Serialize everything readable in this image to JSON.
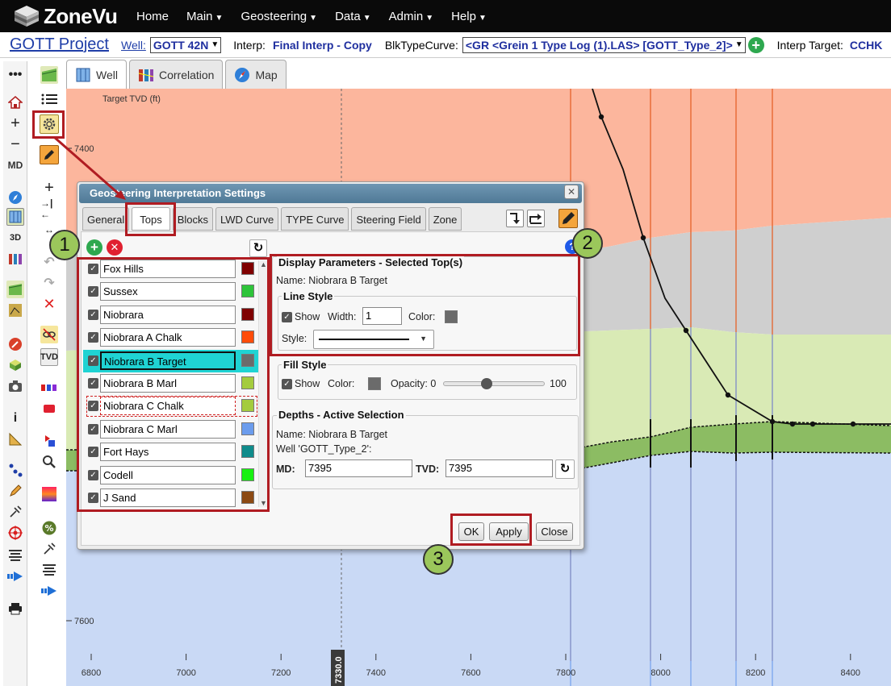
{
  "app": {
    "logo": "ZoneVu"
  },
  "nav": [
    {
      "label": "Home",
      "caret": false
    },
    {
      "label": "Main",
      "caret": true
    },
    {
      "label": "Geosteering",
      "caret": true
    },
    {
      "label": "Data",
      "caret": true
    },
    {
      "label": "Admin",
      "caret": true
    },
    {
      "label": "Help",
      "caret": true
    }
  ],
  "projbar": {
    "project": "GOTT Project",
    "well_label": "Well:",
    "well_value": "GOTT 42N",
    "interp_label": "Interp:",
    "interp_value": "Final Interp - Copy",
    "blk_label": "BlkTypeCurve:",
    "blk_value": "<GR <Grein 1 Type Log (1).LAS> [GOTT_Type_2]>",
    "target_label": "Interp Target:",
    "target_value": "CCHK"
  },
  "view_tabs": [
    {
      "label": "Well",
      "active": true,
      "icon": "well-grid-icon"
    },
    {
      "label": "Correlation",
      "active": false,
      "icon": "correlation-icon"
    },
    {
      "label": "Map",
      "active": false,
      "icon": "compass-icon"
    }
  ],
  "plot": {
    "y_axis_label": "Target TVD (ft)",
    "y_ticks": [
      "7400",
      "7600"
    ],
    "x_ticks": [
      "6800",
      "7000",
      "7200",
      "7400",
      "7600",
      "7800",
      "8000",
      "8200",
      "8400"
    ],
    "cursor_label": "7330.0",
    "colors": {
      "salmon": "#fcb69d",
      "gray": "#cfcfcf",
      "light_green": "#d9eab5",
      "green": "#8cbc63",
      "blue": "#c9d9f5"
    }
  },
  "dialog": {
    "title": "Geosteering Interpretation Settings",
    "tabs": [
      {
        "label": "General",
        "active": false
      },
      {
        "label": "Tops",
        "active": true
      },
      {
        "label": "Blocks",
        "active": false
      },
      {
        "label": "LWD Curve",
        "active": false
      },
      {
        "label": "TYPE Curve",
        "active": false
      },
      {
        "label": "Steering Field",
        "active": false
      },
      {
        "label": "Zone",
        "active": false
      }
    ],
    "tops": [
      {
        "name": "Fox Hills",
        "color": "#7f0000",
        "selected": false
      },
      {
        "name": "Sussex",
        "color": "#2ec43a",
        "selected": false
      },
      {
        "name": "Niobrara",
        "color": "#7f0000",
        "selected": false
      },
      {
        "name": "Niobrara A Chalk",
        "color": "#ff4c0a",
        "selected": false
      },
      {
        "name": "Niobrara B Target",
        "color": "#6b6b6b",
        "selected": true
      },
      {
        "name": "Niobrara B Marl",
        "color": "#a4cc3e",
        "selected": false
      },
      {
        "name": "Niobrara C Chalk",
        "color": "#a4cc3e",
        "selected": false,
        "focused": true
      },
      {
        "name": "Niobrara C Marl",
        "color": "#6b9ced",
        "selected": false
      },
      {
        "name": "Fort Hays",
        "color": "#0f8b8b",
        "selected": false
      },
      {
        "name": "Codell",
        "color": "#18f010",
        "selected": false
      },
      {
        "name": "J Sand",
        "color": "#8c4a14",
        "selected": false
      }
    ],
    "display": {
      "legend": "Display Parameters - Selected Top(s)",
      "name_label": "Name: Niobrara B Target",
      "line_style_legend": "Line Style",
      "show_label": "Show",
      "width_label": "Width:",
      "width_value": "1",
      "color_label": "Color:",
      "line_color": "#6b6b6b",
      "style_label": "Style:"
    },
    "fill": {
      "legend": "Fill Style",
      "show_label": "Show",
      "color_label": "Color:",
      "fill_color": "#6b6b6b",
      "opacity_label": "Opacity: 0",
      "opacity_max": "100",
      "opacity_value": 0.42
    },
    "depths": {
      "legend": "Depths - Active Selection",
      "name_label": "Name: Niobrara B Target",
      "well_label": "Well 'GOTT_Type_2':",
      "md_label": "MD:",
      "md_value": "7395",
      "tvd_label": "TVD:",
      "tvd_value": "7395"
    },
    "buttons": {
      "ok": "OK",
      "apply": "Apply",
      "close": "Close"
    }
  },
  "callouts": [
    "1",
    "2",
    "3"
  ]
}
